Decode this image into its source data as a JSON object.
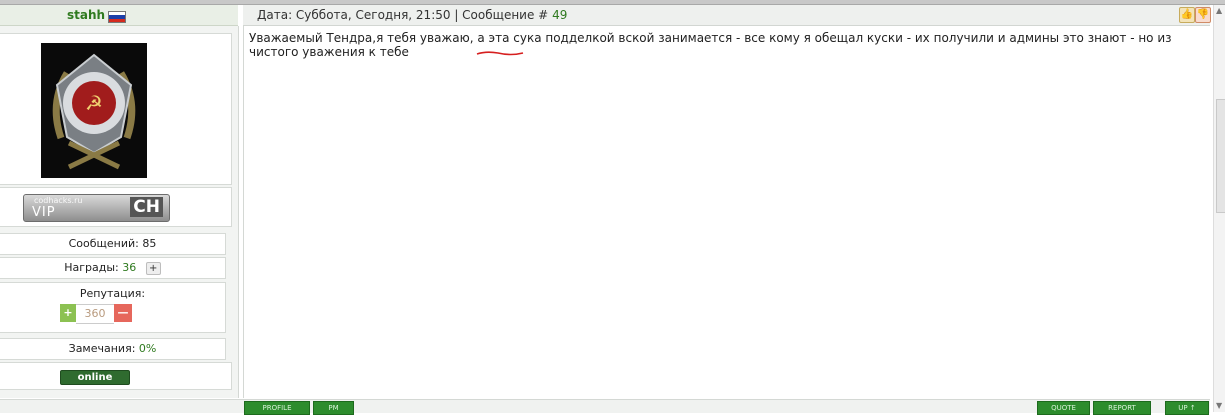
{
  "author": {
    "username": "stahh",
    "flag_colors": [
      "#ffffff",
      "#1c3fa8",
      "#d52b1e"
    ]
  },
  "post": {
    "date_label": "Дата: Суббота, Сегодня, 21:50 | Сообщение #",
    "number": "49",
    "text": "Уважаемый Тендра,я тебя уважаю, а эта сука подделкой вской занимается - все кому я обещал куски - их получили и админы это знают - но из чистого уважения к тебе"
  },
  "stats": {
    "messages_label": "Сообщений:",
    "messages_value": "85",
    "awards_label": "Награды:",
    "awards_value": "36",
    "awards_plus": "+",
    "reputation_label": "Репутация:",
    "reputation_plus": "+",
    "reputation_value": "360",
    "reputation_minus": "—",
    "warnings_label": "Замечания:",
    "warnings_value": "0%",
    "status": "online"
  },
  "vip": {
    "site": "codhacks.ru",
    "text": "VIP",
    "logo": "CH"
  },
  "footer": {
    "profile": "PROFILE",
    "pm": "PM",
    "quote": "QUOTE",
    "report": "REPORT",
    "up": "UP ↑"
  },
  "icons": {
    "thumb_up": "👍",
    "thumb_down": "👎",
    "scroll_up": "▲",
    "scroll_down": "▼"
  },
  "colors": {
    "accent_green": "#2f7a1f",
    "rep_plus": "#8cc152",
    "rep_minus": "#e6675c",
    "online_bg": "#2f6b2f"
  }
}
